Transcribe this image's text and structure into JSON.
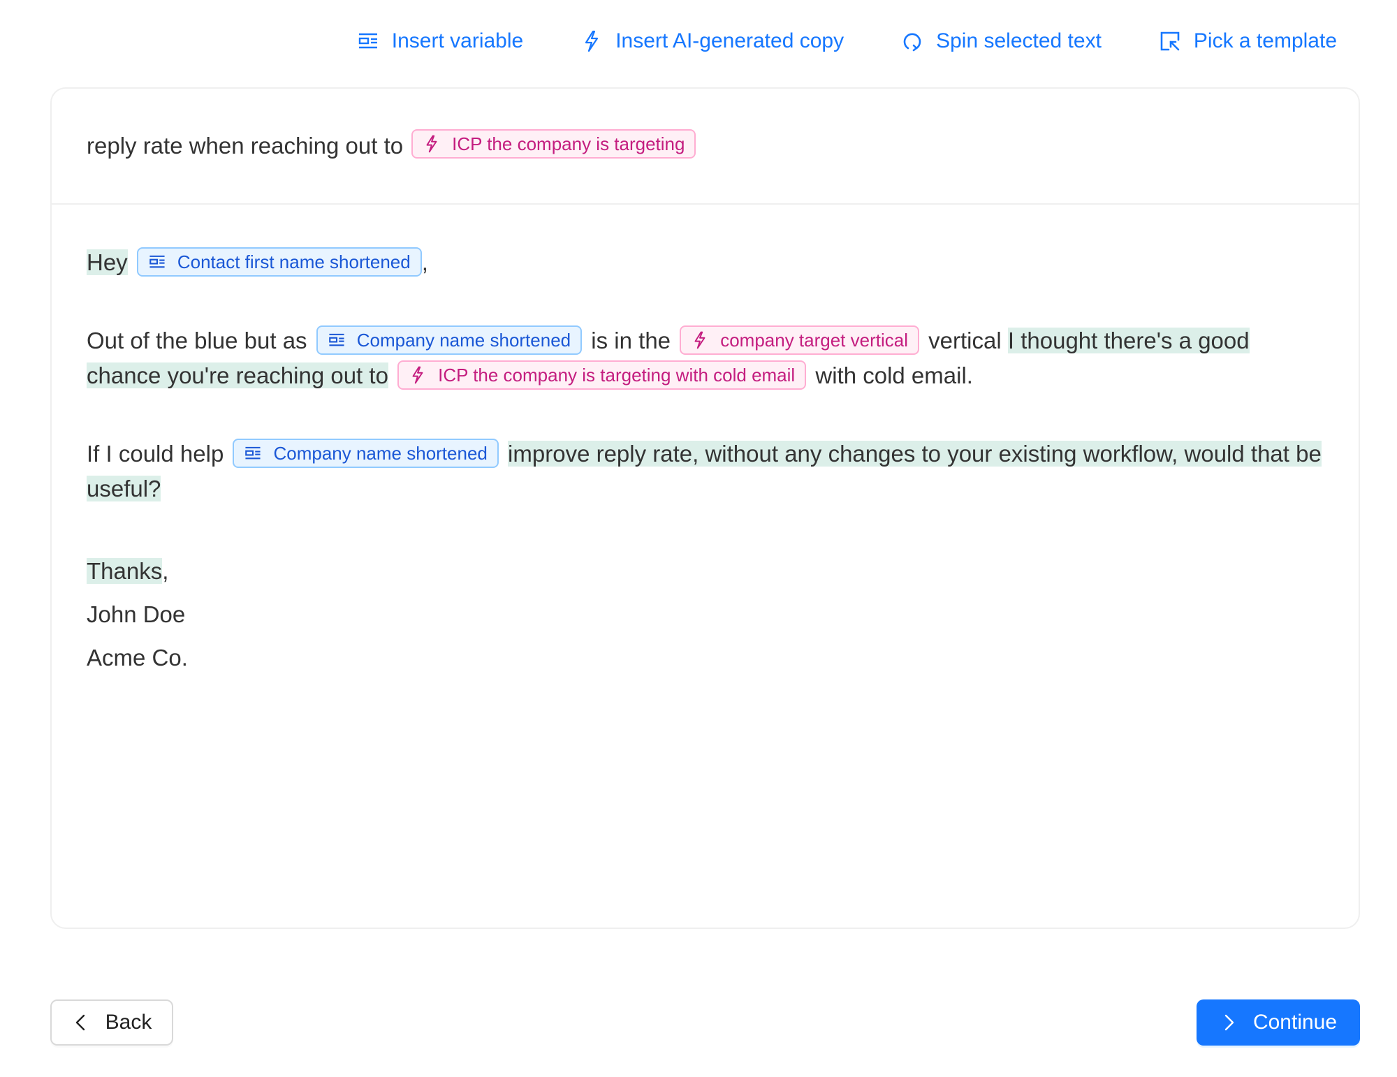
{
  "toolbar": {
    "insert_variable": "Insert variable",
    "insert_ai_copy": "Insert AI-generated copy",
    "spin_text": "Spin selected text",
    "pick_template": "Pick a template"
  },
  "colors": {
    "accent": "#1677ff",
    "variable_chip_text": "#1a57d6",
    "variable_chip_bg": "#e8f4ff",
    "ai_chip_text": "#c41d7f",
    "ai_chip_bg": "#fff0f6",
    "highlight_bg": "#dcefe9"
  },
  "subject": {
    "text": "reply rate when reaching out to",
    "ai_chip": "ICP the company is targeting"
  },
  "body": {
    "greeting": {
      "hey": "Hey",
      "var_chip": "Contact first name shortened",
      "comma": ","
    },
    "para1": {
      "t1": "Out of the blue but as",
      "var_chip": "Company name shortened",
      "t2": "is in the",
      "ai_chip1": "company target vertical",
      "t3": "vertical",
      "t4": "I thought there's a good chance you're reaching out to",
      "ai_chip2": "ICP the company is targeting with cold email",
      "t5": "with cold email."
    },
    "para2": {
      "t1": "If I could help",
      "var_chip": "Company name shortened",
      "t2": "improve reply rate, without any changes to your existing workflow, would that be useful?"
    },
    "signoff": {
      "thanks": "Thanks",
      "comma": ",",
      "name": "John Doe",
      "company": "Acme Co."
    }
  },
  "footer": {
    "back": "Back",
    "continue": "Continue"
  }
}
